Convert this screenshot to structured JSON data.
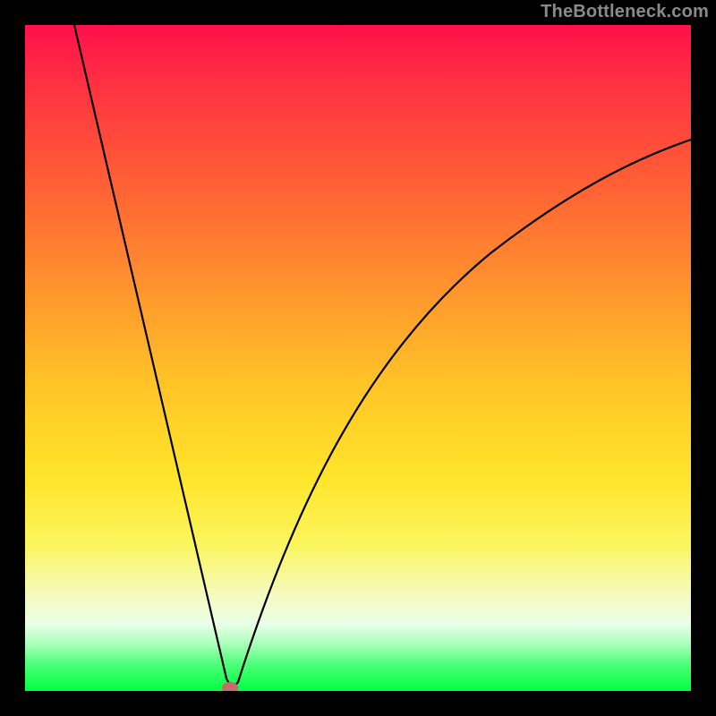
{
  "watermark": "TheBottleneck.com",
  "chart_data": {
    "type": "line",
    "title": "",
    "xlabel": "",
    "ylabel": "",
    "xlim": [
      0,
      100
    ],
    "ylim": [
      0,
      100
    ],
    "grid": false,
    "series": [
      {
        "name": "bottleneck-curve",
        "x": [
          0,
          4,
          8,
          12,
          16,
          20,
          24,
          28,
          30,
          31,
          32,
          34,
          38,
          44,
          50,
          56,
          62,
          70,
          80,
          90,
          100
        ],
        "y": [
          100,
          88,
          75,
          62,
          50,
          38,
          25,
          12,
          4,
          0,
          3,
          11,
          25,
          42,
          54,
          62,
          69,
          76,
          82,
          87,
          90
        ]
      }
    ],
    "annotations": [
      {
        "name": "minimum-marker",
        "x": 31,
        "y": 0,
        "shape": "ellipse",
        "color": "#cf6b6b"
      }
    ],
    "background_gradient": {
      "type": "vertical",
      "stops": [
        {
          "pos": 0.0,
          "color": "#ff0f4a"
        },
        {
          "pos": 0.22,
          "color": "#ff5a36"
        },
        {
          "pos": 0.54,
          "color": "#ffc427"
        },
        {
          "pos": 0.78,
          "color": "#fbf55e"
        },
        {
          "pos": 0.9,
          "color": "#e8ffe8"
        },
        {
          "pos": 1.0,
          "color": "#00ff41"
        }
      ]
    }
  }
}
